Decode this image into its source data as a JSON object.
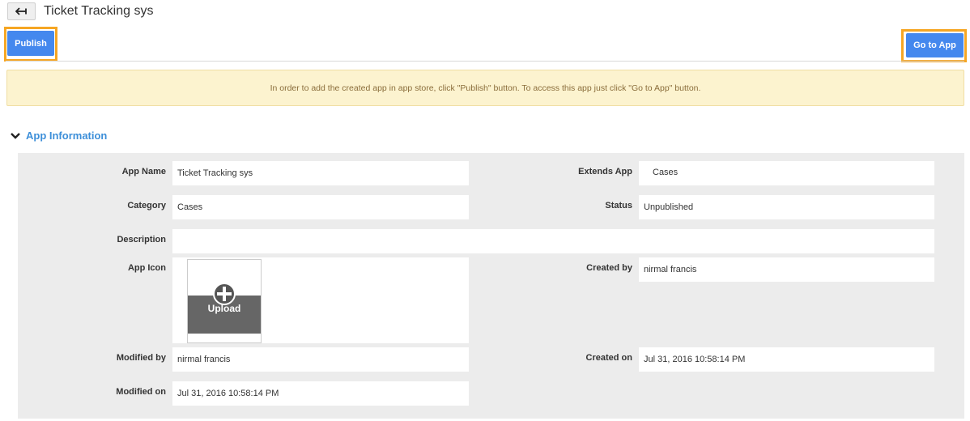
{
  "header": {
    "title": "Ticket Tracking sys",
    "back_icon": "back-arrow-icon"
  },
  "actions": {
    "publish_label": "Publish",
    "goto_label": "Go to App",
    "accent": "#4488ee",
    "highlight": "#f6a623"
  },
  "notice": {
    "text": "In order to add the created app in app store, click \"Publish\" button. To access this app just click \"Go to App\" button."
  },
  "section": {
    "title": "App Information",
    "icon": "chevron-down-icon"
  },
  "fields": {
    "app_name": {
      "label": "App Name",
      "value": "Ticket Tracking sys"
    },
    "extends_app": {
      "label": "Extends App",
      "value": "Cases"
    },
    "category": {
      "label": "Category",
      "value": "Cases"
    },
    "status": {
      "label": "Status",
      "value": "Unpublished"
    },
    "description": {
      "label": "Description",
      "value": ""
    },
    "app_icon": {
      "label": "App Icon",
      "upload_label": "Upload",
      "icon": "plus-circle-icon"
    },
    "created_by": {
      "label": "Created by",
      "value": "nirmal francis"
    },
    "modified_by": {
      "label": "Modified by",
      "value": "nirmal francis"
    },
    "created_on": {
      "label": "Created on",
      "value": "Jul 31, 2016 10:58:14 PM"
    },
    "modified_on": {
      "label": "Modified on",
      "value": "Jul 31, 2016 10:58:14 PM"
    }
  }
}
